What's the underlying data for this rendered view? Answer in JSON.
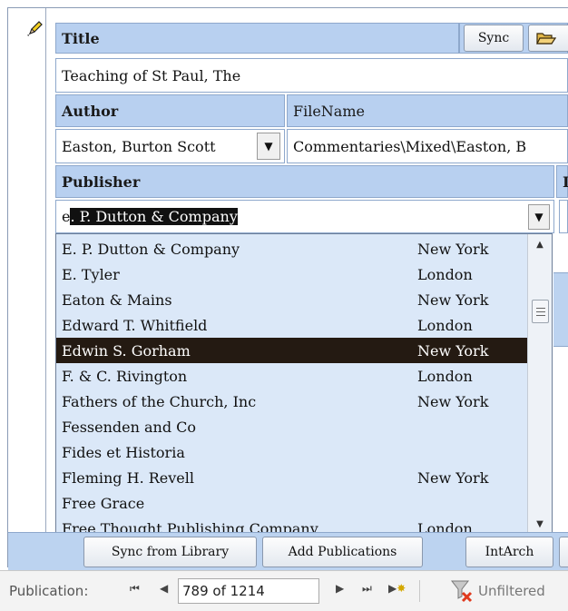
{
  "form": {
    "title_label": "Title",
    "sync_button": "Sync",
    "title_value": "Teaching of St Paul, The",
    "author_label": "Author",
    "filename_label": "FileName",
    "author_value": "Easton, Burton Scott",
    "filename_value": "Commentaries\\Mixed\\Easton, B",
    "publisher_label": "Publisher",
    "publisher_typed": "e",
    "publisher_autocomplete": ". P. Dutton & Company",
    "right_cut_label": "I"
  },
  "dropdown": {
    "rows": [
      {
        "name": "E. P. Dutton & Company",
        "city": "New York"
      },
      {
        "name": "E. Tyler",
        "city": "London"
      },
      {
        "name": "Eaton & Mains",
        "city": "New York"
      },
      {
        "name": "Edward T. Whitfield",
        "city": "London"
      },
      {
        "name": "Edwin S. Gorham",
        "city": "New York"
      },
      {
        "name": "F. & C. Rivington",
        "city": "London"
      },
      {
        "name": "Fathers of the Church, Inc",
        "city": "New York"
      },
      {
        "name": "Fessenden and Co",
        "city": ""
      },
      {
        "name": "Fides et Historia",
        "city": ""
      },
      {
        "name": "Fleming H. Revell",
        "city": "New York"
      },
      {
        "name": "Free Grace",
        "city": ""
      },
      {
        "name": "Free Thought Publishing Company",
        "city": "London"
      }
    ],
    "selected_index": 4
  },
  "buttons": {
    "sync_from_library": "Sync from Library",
    "add_publications": "Add Publications",
    "intarch": "IntArch"
  },
  "status": {
    "label": "Publication:",
    "record": "789 of 1214",
    "filter": "Unfiltered"
  },
  "icons": {
    "pencil": "pencil-icon",
    "folder": "open-folder-icon",
    "funnel": "filter-clear-icon"
  }
}
